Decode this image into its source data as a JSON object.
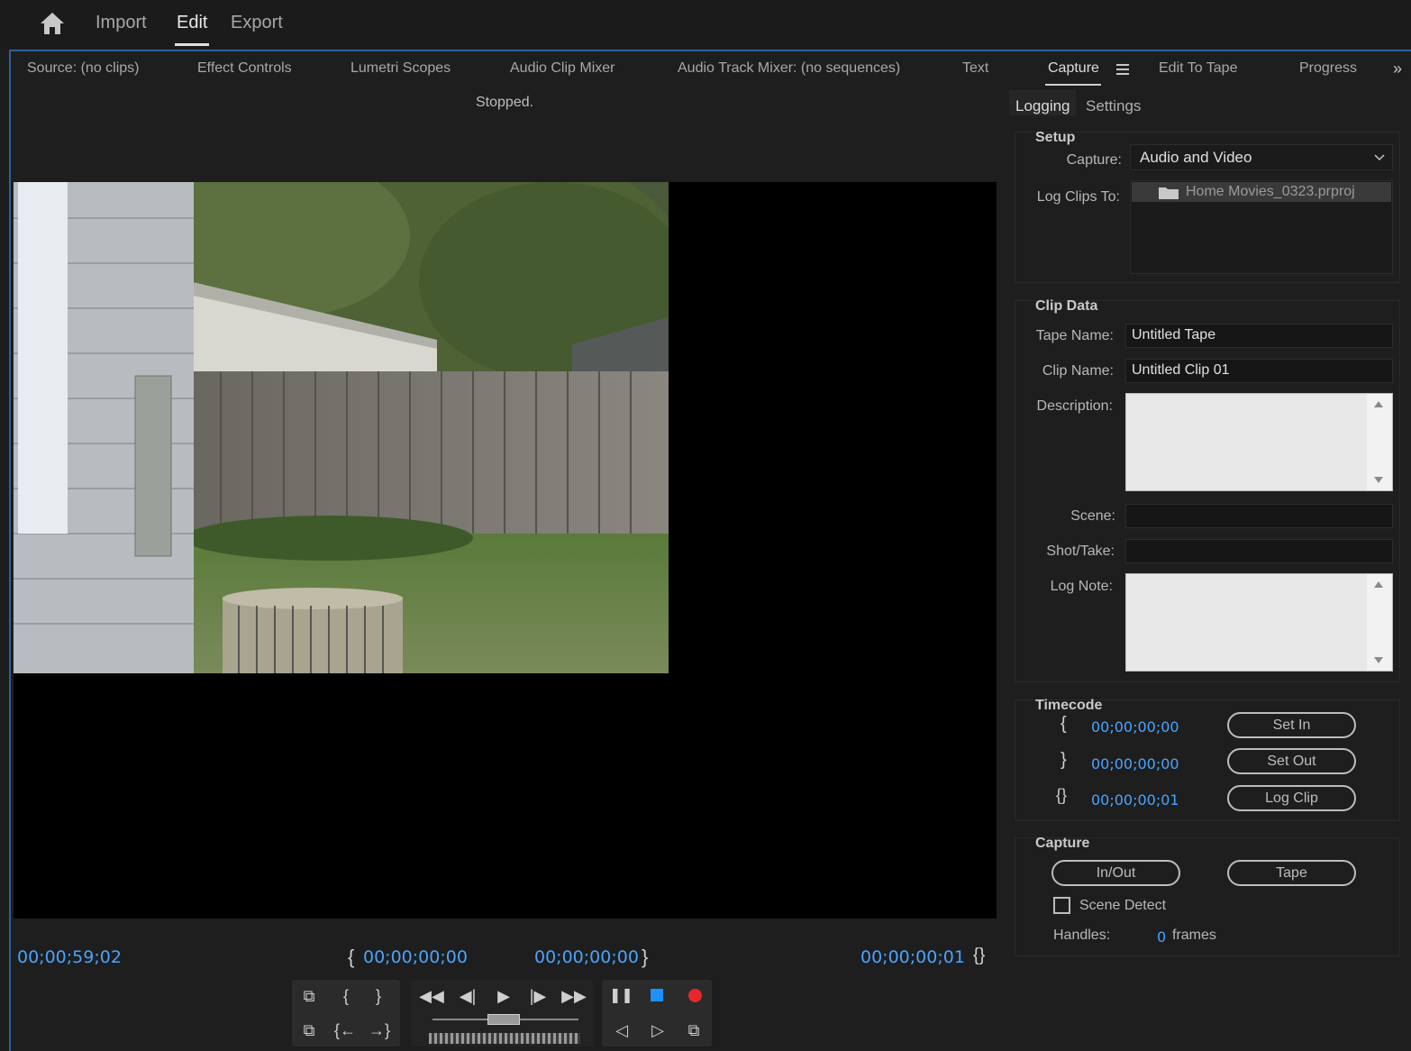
{
  "topnav": {
    "import": "Import",
    "edit": "Edit",
    "export": "Export"
  },
  "tabs": {
    "source": "Source: (no clips)",
    "effect_controls": "Effect Controls",
    "lumetri_scopes": "Lumetri Scopes",
    "audio_clip_mixer": "Audio Clip Mixer",
    "audio_track_mixer": "Audio Track Mixer: (no sequences)",
    "text": "Text",
    "capture": "Capture",
    "edit_to_tape": "Edit To Tape",
    "progress": "Progress",
    "overflow": "»"
  },
  "status": "Stopped.",
  "timecodes": {
    "current": "00;00;59;02",
    "in": "00;00;00;00",
    "out": "00;00;00;00",
    "duration": "00;00;00;01"
  },
  "right": {
    "tabs": {
      "logging": "Logging",
      "settings": "Settings"
    },
    "setup": {
      "title": "Setup",
      "capture_label": "Capture:",
      "capture_value": "Audio and Video",
      "log_clips_label": "Log Clips To:",
      "log_clips_value": "Home Movies_0323.prproj"
    },
    "clip_data": {
      "title": "Clip Data",
      "tape_name_label": "Tape Name:",
      "tape_name_value": "Untitled Tape",
      "clip_name_label": "Clip Name:",
      "clip_name_value": "Untitled Clip 01",
      "description_label": "Description:",
      "scene_label": "Scene:",
      "shot_take_label": "Shot/Take:",
      "log_note_label": "Log Note:"
    },
    "timecode": {
      "title": "Timecode",
      "in_value": "00;00;00;00",
      "out_value": "00;00;00;00",
      "duration_value": "00;00;00;01",
      "set_in": "Set In",
      "set_out": "Set Out",
      "log_clip": "Log Clip"
    },
    "capture": {
      "title": "Capture",
      "in_out": "In/Out",
      "tape": "Tape",
      "scene_detect": "Scene Detect",
      "handles_label": "Handles:",
      "handles_value": "0",
      "frames": "frames"
    }
  },
  "colors": {
    "accent": "#4aa3ff",
    "record": "#e8262e",
    "stop": "#1e90ff"
  }
}
